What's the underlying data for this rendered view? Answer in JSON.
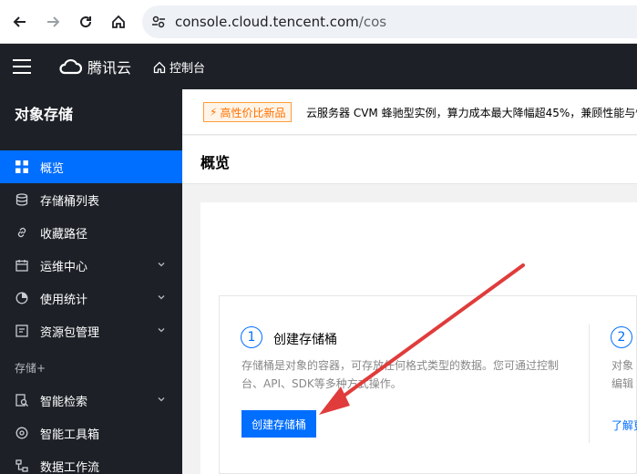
{
  "browser": {
    "url_host": "console.cloud.tencent.com",
    "url_path": "/cos"
  },
  "topnav": {
    "brand": "腾讯云",
    "console": "控制台"
  },
  "sidebar": {
    "title": "对象存储",
    "items": [
      {
        "label": "概览",
        "icon": "grid-icon",
        "active": true
      },
      {
        "label": "存储桶列表",
        "icon": "database-icon"
      },
      {
        "label": "收藏路径",
        "icon": "link-icon"
      },
      {
        "label": "运维中心",
        "icon": "calendar-icon",
        "expandable": true
      },
      {
        "label": "使用统计",
        "icon": "pie-chart-icon",
        "expandable": true
      },
      {
        "label": "资源包管理",
        "icon": "package-icon",
        "expandable": true
      }
    ],
    "group_label": "存储+",
    "group_items": [
      {
        "label": "智能检索",
        "icon": "search-doc-icon",
        "expandable": true
      },
      {
        "label": "智能工具箱",
        "icon": "tools-icon"
      },
      {
        "label": "数据工作流",
        "icon": "workflow-icon"
      }
    ]
  },
  "banner": {
    "badge": "高性价比新品",
    "text": "云服务器 CVM 蜂驰型实例，算力成本最大降幅超45%，兼顾性能与性"
  },
  "page": {
    "title": "概览"
  },
  "steps": [
    {
      "number": "1",
      "title": "创建存储桶",
      "description_line1": "存储桶是对象的容器，可存放任何格式类型的数据。您可通过控制",
      "description_line2": "台、API、SDK等多种方式操作。",
      "button": "创建存储桶"
    },
    {
      "number": "2",
      "description_line1": "对象",
      "description_line2": "编辑",
      "link": "了解更"
    }
  ],
  "colors": {
    "accent": "#006eff",
    "annotation_arrow": "#e03c3c",
    "sidebar_bg": "#1d2127"
  }
}
